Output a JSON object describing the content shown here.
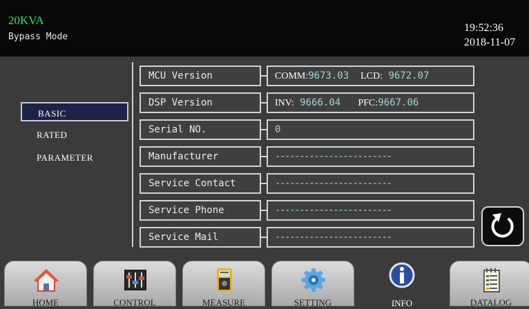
{
  "header": {
    "model": "20KVA",
    "mode": "Bypass Mode",
    "time": "19:52:36",
    "date": "2018-11-07"
  },
  "menu": {
    "basic": "BASIC",
    "rated": "RATED",
    "parameter": "PARAMETER"
  },
  "info": {
    "mcu_label": "MCU Version",
    "mcu_comm_key": "COMM:",
    "mcu_comm_val": "9673.03",
    "mcu_lcd_key": "LCD:",
    "mcu_lcd_val": "9672.07",
    "dsp_label": "DSP Version",
    "dsp_inv_key": "INV:",
    "dsp_inv_val": "9666.04",
    "dsp_pfc_key": "PFC:",
    "dsp_pfc_val": "9667.06",
    "serial_label": "Serial NO.",
    "serial_val": "0",
    "manufacturer_label": "Manufacturer",
    "manufacturer_val": "------------------------",
    "contact_label": "Service Contact",
    "contact_val": "------------------------",
    "phone_label": "Service Phone",
    "phone_val": "------------------------",
    "mail_label": "Service Mail",
    "mail_val": "------------------------"
  },
  "nav": {
    "home": "HOME",
    "control": "CONTROL",
    "measure": "MEASURE",
    "setting": "SETTING",
    "info": "INFO",
    "datalog": "DATALOG"
  },
  "icons": {
    "back": "refresh-icon",
    "home": "house-icon",
    "control": "sliders-icon",
    "measure": "multimeter-icon",
    "setting": "gear-icon",
    "info": "info-icon",
    "datalog": "notepad-icon"
  },
  "colors": {
    "accent_green": "#39e35a",
    "value_cyan": "#9fd6d6",
    "selected_bg": "#1c2346"
  }
}
